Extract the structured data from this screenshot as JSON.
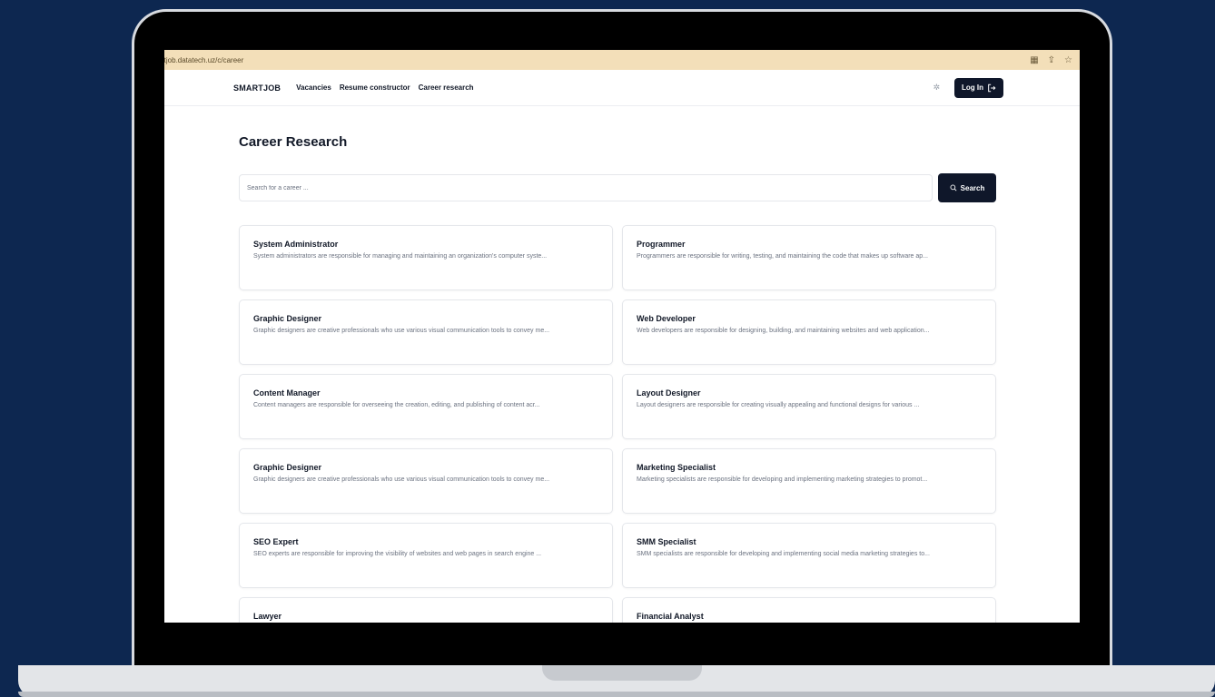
{
  "browser": {
    "url": "rtjob.datatech.uz/c/career",
    "icons": [
      "translate-icon",
      "share-icon",
      "star-icon"
    ]
  },
  "navbar": {
    "brand": "SMARTJOB",
    "links": [
      "Vacancies",
      "Resume constructor",
      "Career research"
    ],
    "login_label": "Log In"
  },
  "page": {
    "title": "Career Research",
    "search_placeholder": "Search for a career ...",
    "search_button": "Search"
  },
  "careers": [
    {
      "title": "System Administrator",
      "description": "System administrators are responsible for managing and maintaining an organization's computer syste..."
    },
    {
      "title": "Programmer",
      "description": "Programmers are responsible for writing, testing, and maintaining the code that makes up software ap..."
    },
    {
      "title": "Graphic Designer",
      "description": "Graphic designers are creative professionals who use various visual communication tools to convey me..."
    },
    {
      "title": "Web Developer",
      "description": "Web developers are responsible for designing, building, and maintaining websites and web application..."
    },
    {
      "title": "Content Manager",
      "description": "Content managers are responsible for overseeing the creation, editing, and publishing of content acr..."
    },
    {
      "title": "Layout Designer",
      "description": "Layout designers are responsible for creating visually appealing and functional designs for various ..."
    },
    {
      "title": "Graphic Designer",
      "description": "Graphic designers are creative professionals who use various visual communication tools to convey me..."
    },
    {
      "title": "Marketing Specialist",
      "description": "Marketing specialists are responsible for developing and implementing marketing strategies to promot..."
    },
    {
      "title": "SEO Expert",
      "description": "SEO experts are responsible for improving the visibility of websites and web pages in search engine ..."
    },
    {
      "title": "SMM Specialist",
      "description": "SMM specialists are responsible for developing and implementing social media marketing strategies to..."
    },
    {
      "title": "Lawyer",
      "description": ""
    },
    {
      "title": "Financial Analyst",
      "description": ""
    }
  ],
  "colors": {
    "background": "#0d2750",
    "primary_button": "#0f172a",
    "address_bar": "#f3dfb9"
  }
}
